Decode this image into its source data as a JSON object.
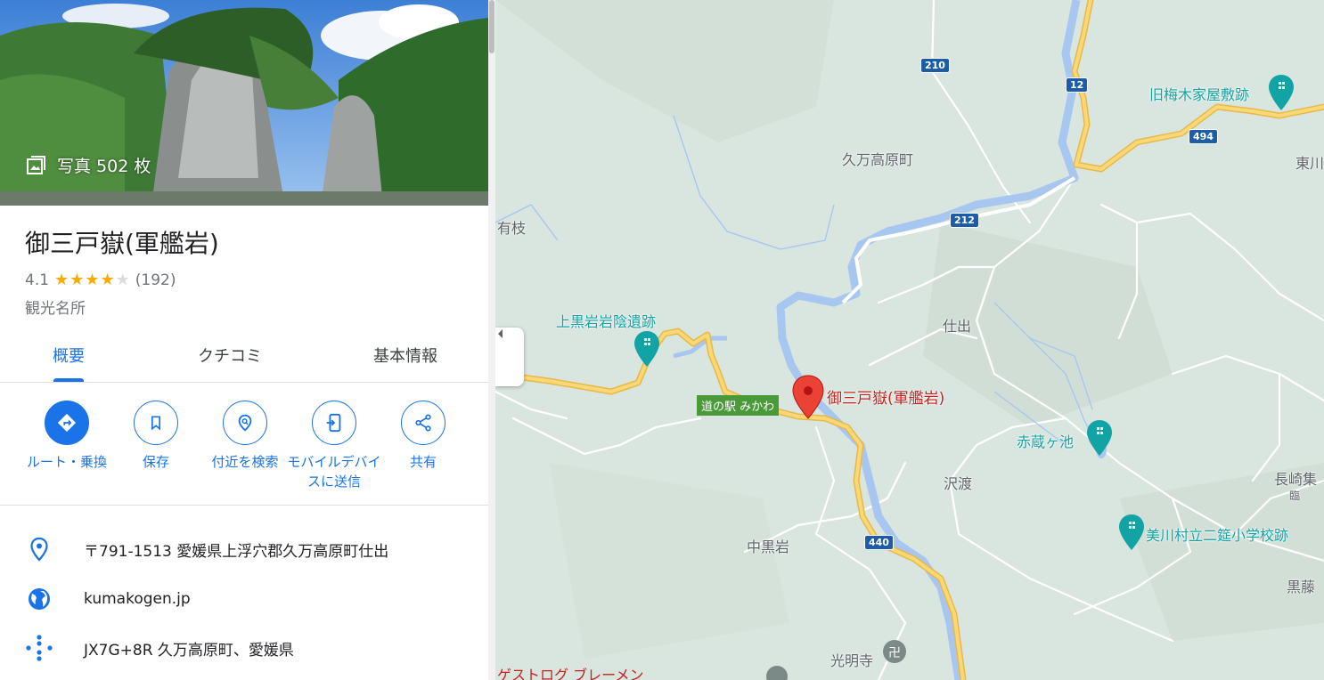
{
  "place": {
    "photo_count": "写真 502 枚",
    "title": "御三戸嶽(軍艦岩)",
    "rating": "4.1",
    "stars": 4.1,
    "review_count": "(192)",
    "category": "観光名所"
  },
  "tabs": [
    {
      "label": "概要"
    },
    {
      "label": "クチコミ"
    },
    {
      "label": "基本情報"
    }
  ],
  "actions": [
    {
      "label": "ルート・乗換",
      "icon": "directions-icon"
    },
    {
      "label": "保存",
      "icon": "bookmark-icon"
    },
    {
      "label": "付近を検索",
      "icon": "nearby-search-icon"
    },
    {
      "label": "モバイルデバイスに送信",
      "icon": "send-to-phone-icon"
    },
    {
      "label": "共有",
      "icon": "share-icon"
    }
  ],
  "info": {
    "address": "〒791-1513 愛媛県上浮穴郡久万高原町仕出",
    "website": "kumakogen.jp",
    "plus_code": "JX7G+8R 久万高原町、愛媛県"
  },
  "map": {
    "pin_label": "御三戸嶽(軍艦岩)",
    "michinoeki": "道の駅 みかわ",
    "town_labels": [
      "久万高原町",
      "有枝",
      "仕出",
      "沢渡",
      "中黒岩",
      "東川",
      "長崎集",
      "臨",
      "黒藤",
      "光明寺"
    ],
    "poi_labels": [
      "上黒岩岩陰遺跡",
      "旧梅木家屋敷跡",
      "赤蔵ヶ池",
      "美川村立二筵小学校跡"
    ],
    "road_shields": [
      "210",
      "12",
      "494",
      "212",
      "440"
    ],
    "bottom_label": "ゲストログ ブレーメン"
  },
  "colors": {
    "accent": "#1a73e8",
    "pin": "#ea4335",
    "poi": "#12a4a4",
    "road_major": "#f6cf65",
    "river": "#a8c7f0",
    "map_bg": "#d9e5df"
  }
}
